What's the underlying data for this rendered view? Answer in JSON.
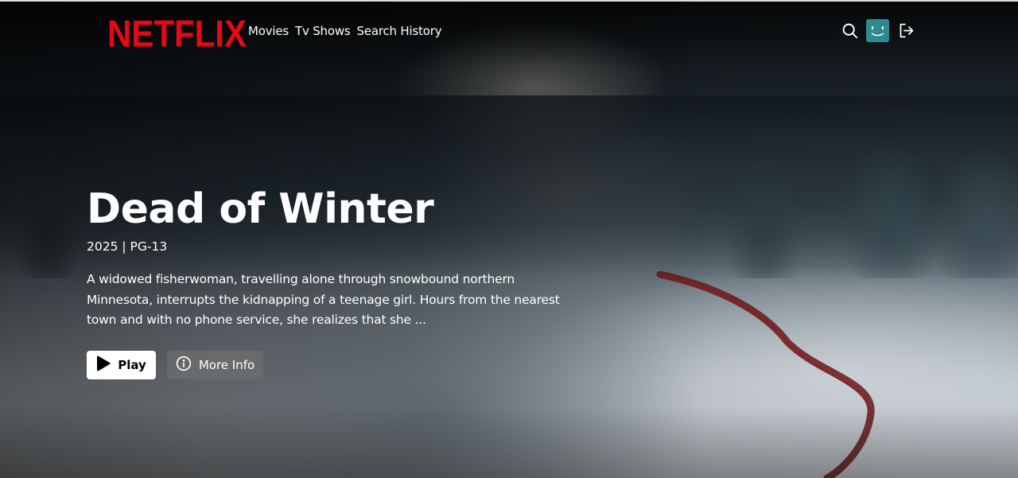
{
  "brand": {
    "logo_text": "NETFLIX",
    "logo_color": "#e50914"
  },
  "nav": {
    "links": [
      {
        "label": "Movies"
      },
      {
        "label": "Tv Shows"
      },
      {
        "label": "Search History"
      }
    ],
    "icons": {
      "search": "search-icon",
      "avatar": "avatar",
      "logout": "logout-icon"
    },
    "avatar_color": "#2e8a8e"
  },
  "hero": {
    "title": "Dead of Winter",
    "meta": "2025 | PG-13",
    "description": "A widowed fisherwoman, travelling alone through snowbound northern Minnesota, interrupts the kidnapping of a teenage girl. Hours from the nearest town and with no phone service, she realizes that she ...",
    "actions": {
      "play_label": "Play",
      "play_icon": "play-icon",
      "info_label": "More Info",
      "info_icon": "info-icon"
    }
  }
}
